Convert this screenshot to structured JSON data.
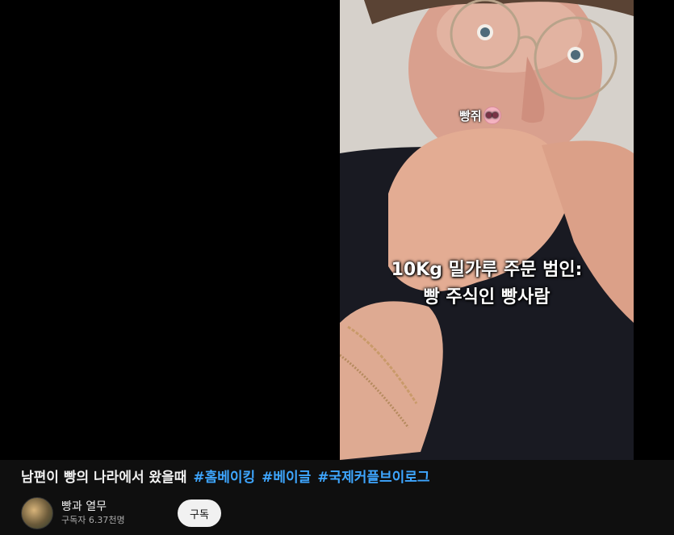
{
  "video": {
    "caption_top": "빵쥐",
    "caption_line1": "10Kg 밀가루 주문 범인:",
    "caption_line2": "빵 주식인 빵사람"
  },
  "title": {
    "text": "남편이 빵의 나라에서 왔을때",
    "tags": [
      "#홈베이킹",
      "#베이글",
      "#국제커플브이로그"
    ]
  },
  "owner": {
    "channel_name": "빵과 열무",
    "subscribers": "구독자 6.37천명",
    "subscribe_label": "구독"
  },
  "colors": {
    "hashtag": "#3ea6ff",
    "page_bg": "#0f0f0f"
  }
}
